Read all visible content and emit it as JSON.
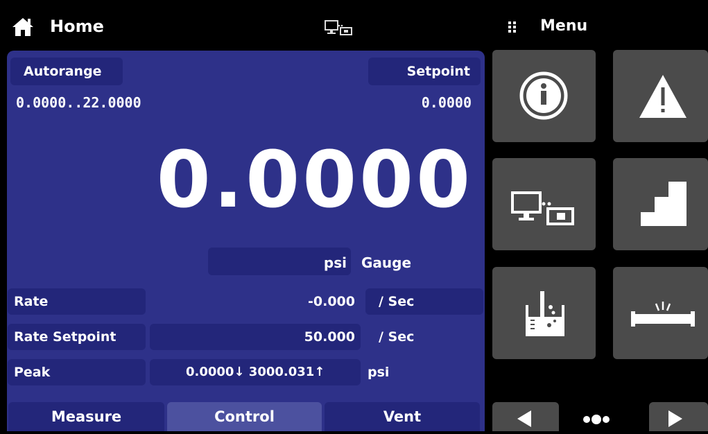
{
  "header": {
    "home_title": "Home",
    "menu_title": "Menu",
    "icons": [
      "home-icon",
      "remote-icon",
      "menu-dots-icon"
    ]
  },
  "main": {
    "autorange_label": "Autorange",
    "range_text": "0.0000..22.0000",
    "setpoint_label": "Setpoint",
    "setpoint_value": "0.0000",
    "reading": "0.0000",
    "unit": "psi",
    "mode": "Gauge",
    "rows": {
      "rate": {
        "label": "Rate",
        "value": "-0.000",
        "unit": "/ Sec"
      },
      "rate_setpoint": {
        "label": "Rate Setpoint",
        "value": "50.000",
        "unit": "/ Sec"
      },
      "peak": {
        "label": "Peak",
        "value": "0.0000↓ 3000.031↑",
        "unit": "psi"
      }
    }
  },
  "tabs": [
    {
      "label": "Measure"
    },
    {
      "label": "Control"
    },
    {
      "label": "Vent"
    }
  ],
  "menu": {
    "tiles": [
      "info-icon",
      "alert-icon",
      "remote-icon",
      "steps-icon",
      "purge-icon",
      "leak-icon"
    ],
    "nav": [
      "prev-arrow-icon",
      "page-dots-icon",
      "next-arrow-icon"
    ]
  },
  "colors": {
    "panel": "#2e3189",
    "chip": "#23267a",
    "active_tab": "#4c519f",
    "tile": "#4b4b4b",
    "background": "#000000"
  }
}
